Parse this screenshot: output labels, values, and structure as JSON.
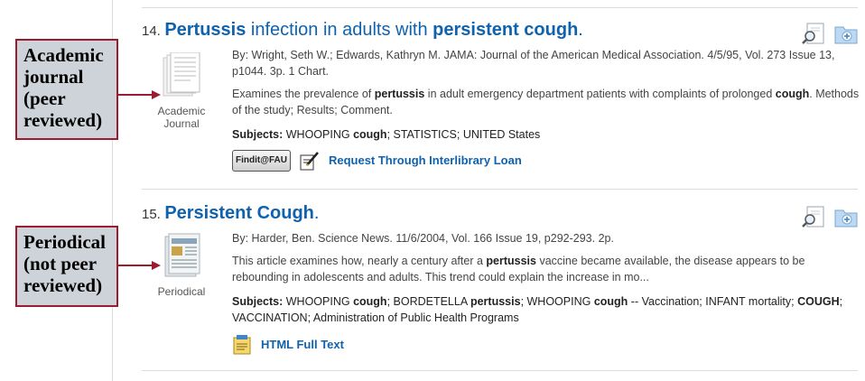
{
  "callouts": {
    "first": "Academic\njournal\n(peer\nreviewed)",
    "second": "Periodical\n(not peer\nreviewed)"
  },
  "records": [
    {
      "number": "14.",
      "title_parts": [
        "Pertussis",
        " infection in adults with ",
        "persistent cough",
        "."
      ],
      "pubtype": [
        "Academic",
        "Journal"
      ],
      "pubtype_icon": "academic-journal-icon",
      "citation": "By: Wright, Seth W.; Edwards, Kathryn M. JAMA: Journal of the American Medical Association. 4/5/95, Vol. 273 Issue 13, p1044. 3p. 1 Chart.",
      "abstract_parts": [
        "Examines the prevalence of ",
        "pertussis",
        " in adult emergency department patients with complaints of prolonged ",
        "cough",
        ". Methods of the study; Results; Comment."
      ],
      "subjects_label": "Subjects:",
      "subjects_parts": [
        "WHOOPING ",
        "cough",
        "; STATISTICS; UNITED States"
      ],
      "findit_label": "Findit@FAU",
      "ill_label": "Request Through Interlibrary Loan"
    },
    {
      "number": "15.",
      "title_parts": [
        "Persistent Cough",
        "."
      ],
      "pubtype": [
        "Periodical"
      ],
      "pubtype_icon": "periodical-icon",
      "citation": "By: Harder, Ben. Science News. 11/6/2004, Vol. 166 Issue 19, p292-293. 2p.",
      "abstract_parts": [
        "This article examines how, nearly a century after a ",
        "pertussis",
        " vaccine became available, the disease appears to be rebounding in adolescents and adults. This trend could explain the increase in mo..."
      ],
      "subjects_label": "Subjects:",
      "subjects_parts": [
        "WHOOPING ",
        "cough",
        "; BORDETELLA ",
        "pertussis",
        "; WHOOPING ",
        "cough",
        " -- Vaccination; INFANT mortality; ",
        "COUGH",
        "; VACCINATION; Administration of Public Health Programs"
      ],
      "fulltext_label": "HTML Full Text"
    }
  ],
  "colors": {
    "link": "#0f62ae",
    "callout_border": "#9b1b30",
    "callout_bg": "#cdd3d9"
  }
}
